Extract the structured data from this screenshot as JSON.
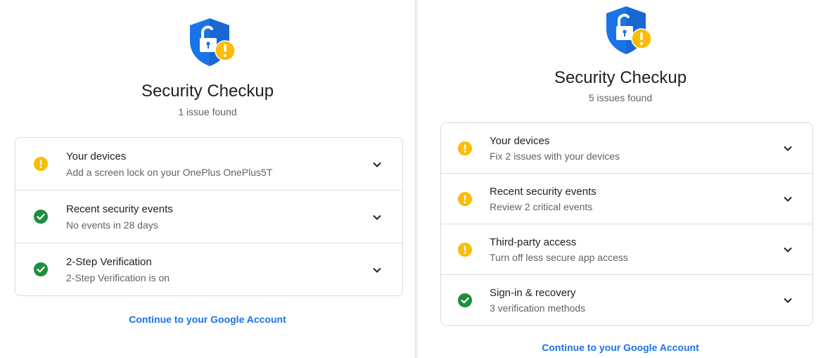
{
  "left": {
    "logo_icon": "shield-lock-warning-icon",
    "title": "Security Checkup",
    "subtitle": "1 issue found",
    "items": [
      {
        "status": "warning",
        "status_icon": "warning-icon",
        "title": "Your devices",
        "description": "Add a screen lock on your OnePlus OnePlus5T"
      },
      {
        "status": "ok",
        "status_icon": "check-icon",
        "title": "Recent security events",
        "description": "No events in 28 days"
      },
      {
        "status": "ok",
        "status_icon": "check-icon",
        "title": "2-Step Verification",
        "description": "2-Step Verification is on"
      }
    ],
    "continue_link": "Continue to your Google Account"
  },
  "right": {
    "logo_icon": "shield-lock-warning-icon",
    "title": "Security Checkup",
    "subtitle": "5 issues found",
    "items": [
      {
        "status": "warning",
        "status_icon": "warning-icon",
        "title": "Your devices",
        "description": "Fix 2 issues with your devices"
      },
      {
        "status": "warning",
        "status_icon": "warning-icon",
        "title": "Recent security events",
        "description": "Review 2 critical events"
      },
      {
        "status": "warning",
        "status_icon": "warning-icon",
        "title": "Third-party access",
        "description": "Turn off less secure app access"
      },
      {
        "status": "ok",
        "status_icon": "check-icon",
        "title": "Sign-in & recovery",
        "description": "3 verification methods"
      }
    ],
    "continue_link": "Continue to your Google Account"
  },
  "colors": {
    "shield_blue": "#1a73e8",
    "shield_dark": "#1967d2",
    "warning_yellow": "#fbbc04",
    "ok_green": "#1e8e3e",
    "link_blue": "#1a73e8",
    "border": "#dadce0"
  }
}
